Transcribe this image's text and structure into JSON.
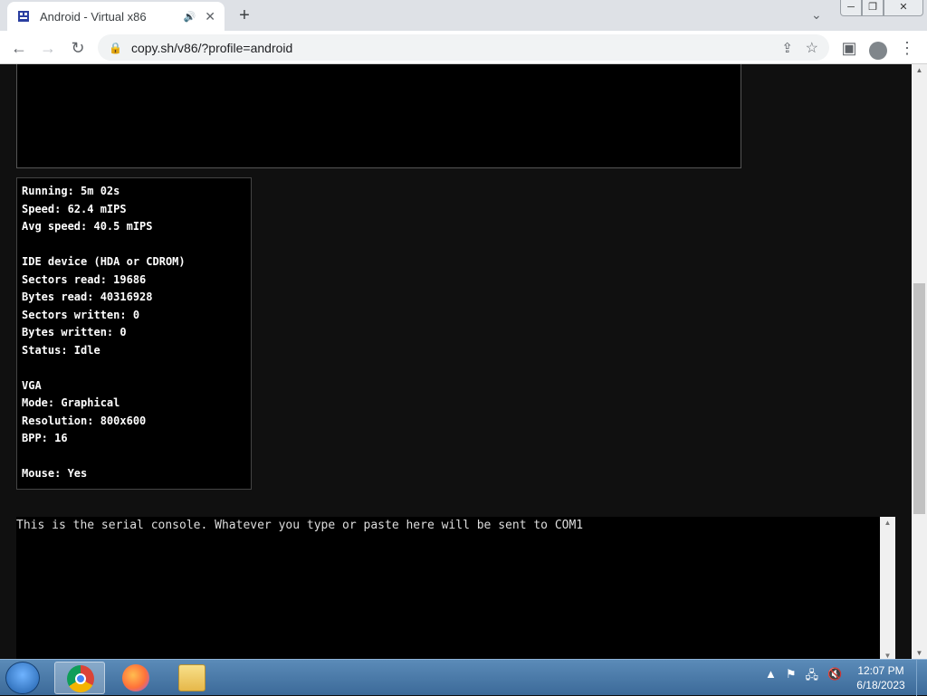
{
  "browser": {
    "tab_title": "Android - Virtual x86",
    "url": "copy.sh/v86/?profile=android",
    "new_tab": "+",
    "tab_close": "✕",
    "tab_audio": "🔊"
  },
  "window_controls": {
    "minimize": "─",
    "maximize": "❐",
    "close": "✕"
  },
  "stats": {
    "running": "Running: 5m 02s",
    "speed": "Speed: 62.4 mIPS",
    "avg_speed": "Avg speed: 40.5 mIPS",
    "ide_header": "IDE device (HDA or CDROM)",
    "sectors_read": "Sectors read: 19686",
    "bytes_read": "Bytes read: 40316928",
    "sectors_written": "Sectors written: 0",
    "bytes_written": "Bytes written: 0",
    "status": "Status: Idle",
    "vga_header": "VGA",
    "mode": "Mode: Graphical",
    "resolution": "Resolution: 800x600",
    "bpp": "BPP: 16",
    "mouse": "Mouse: Yes"
  },
  "console": {
    "text": "This is the serial console. Whatever you type or paste here will be sent to COM1"
  },
  "taskbar": {
    "time": "12:07 PM",
    "date": "6/18/2023",
    "apps": [
      "chrome-icon",
      "firefox-icon",
      "file-explorer-icon"
    ]
  },
  "colors": {
    "page_bg": "#101010",
    "console_bg": "#000000",
    "taskbar": "#3c6a99"
  }
}
